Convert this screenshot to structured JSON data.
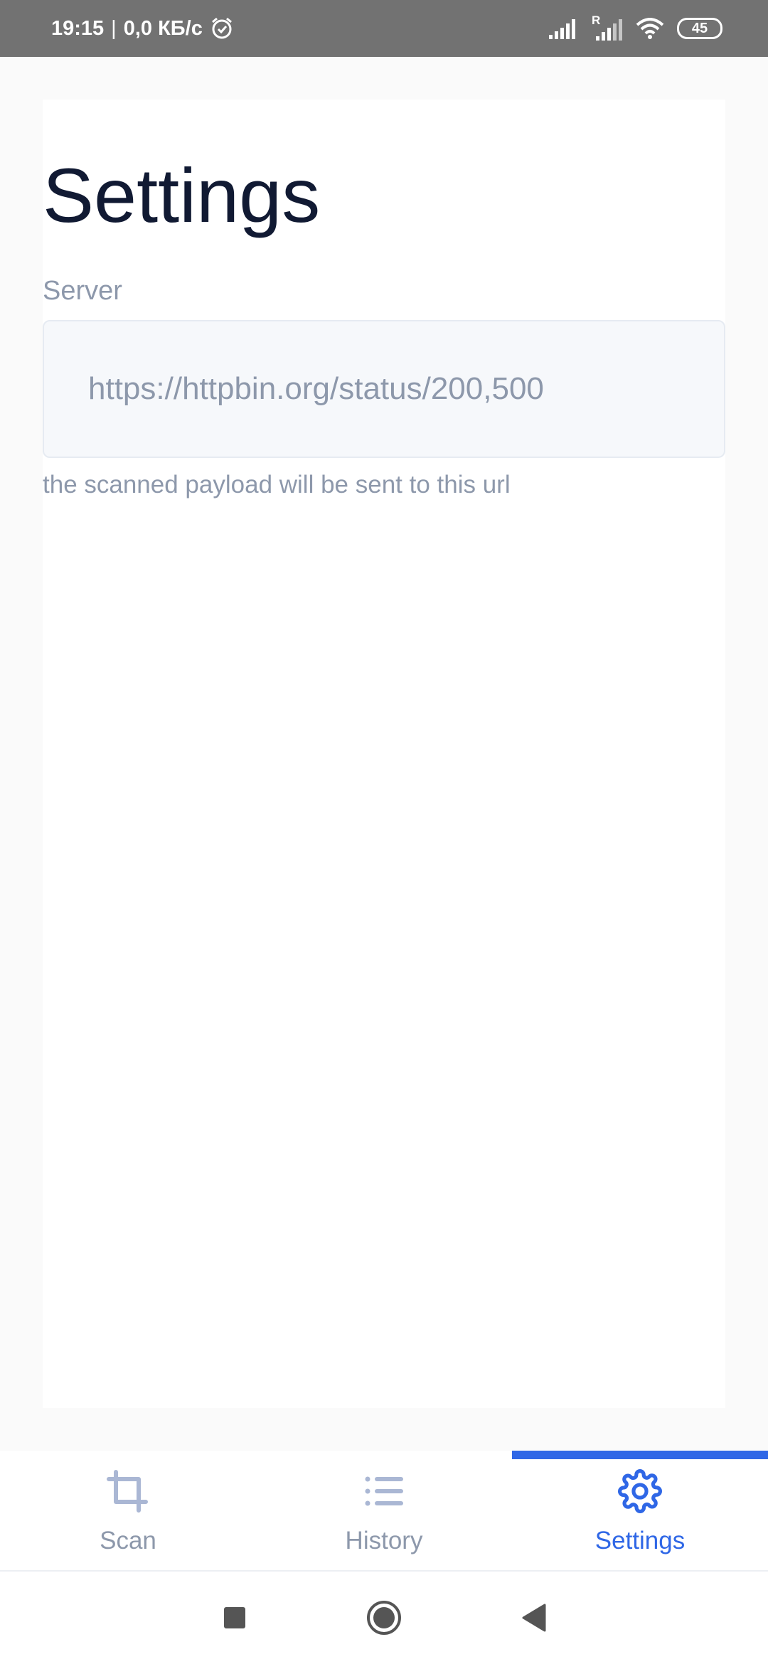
{
  "status_bar": {
    "time": "19:15",
    "separator": "|",
    "data_rate": "0,0 КБ/с",
    "roaming_label": "R",
    "battery": "45"
  },
  "page": {
    "title": "Settings"
  },
  "server_field": {
    "label": "Server",
    "value": "https://httpbin.org/status/200,500",
    "helper": "the scanned payload will be sent to this url"
  },
  "tabs": [
    {
      "label": "Scan",
      "icon": "crop-icon",
      "active": false
    },
    {
      "label": "History",
      "icon": "list-icon",
      "active": false
    },
    {
      "label": "Settings",
      "icon": "gear-icon",
      "active": true
    }
  ],
  "colors": {
    "accent": "#2f67e6",
    "title": "#111a33",
    "muted": "#8d98ab",
    "status_bar": "#727272"
  },
  "nav_bar": {
    "buttons": [
      "recents-icon",
      "home-icon",
      "back-icon"
    ]
  }
}
